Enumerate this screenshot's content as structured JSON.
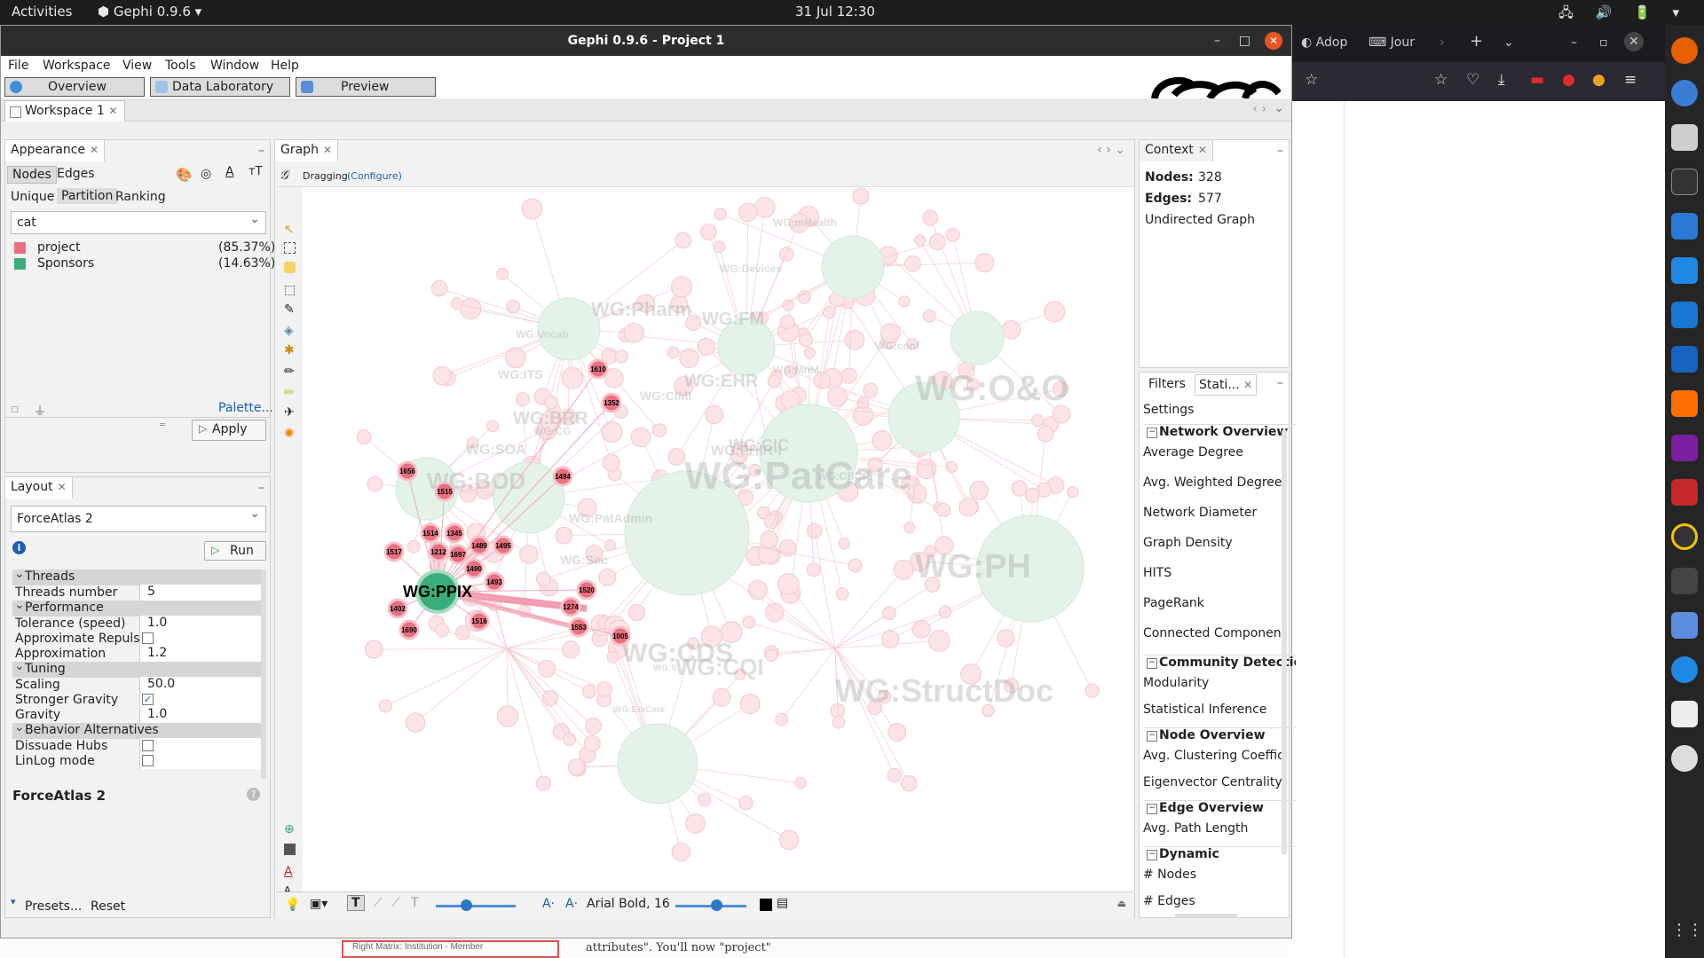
{
  "topbar": {
    "activities": "Activities",
    "app": "Gephi 0.9.6",
    "clock": "31 Jul  12:30",
    "tray": "🖧 🔊 🔋 ▾"
  },
  "window": {
    "title": "Gephi 0.9.6 - Project 1"
  },
  "menu": [
    "File",
    "Workspace",
    "View",
    "Tools",
    "Window",
    "Help"
  ],
  "modes": [
    "Overview",
    "Data Laboratory",
    "Preview"
  ],
  "workspace_tab": "Workspace 1",
  "appearance": {
    "tab": "Appearance",
    "subtabs": [
      "Nodes",
      "Edges"
    ],
    "modes": [
      "Unique",
      "Partition",
      "Ranking"
    ],
    "attribute": "cat",
    "partitions": [
      {
        "label": "project",
        "pct": "(85.37%)",
        "color": "#e8707f"
      },
      {
        "label": "Sponsors",
        "pct": "(14.63%)",
        "color": "#3aae7a"
      }
    ],
    "palette": "Palette...",
    "apply": "Apply"
  },
  "layout": {
    "tab": "Layout",
    "algorithm": "ForceAtlas 2",
    "run": "Run",
    "groups": [
      {
        "name": "Threads",
        "rows": [
          {
            "k": "Threads number",
            "v": "5"
          }
        ]
      },
      {
        "name": "Performance",
        "rows": [
          {
            "k": "Tolerance (speed)",
            "v": "1.0"
          },
          {
            "k": "Approximate Repulsion",
            "v": "",
            "cb": true,
            "checked": false
          },
          {
            "k": "Approximation",
            "v": "1.2"
          }
        ]
      },
      {
        "name": "Tuning",
        "rows": [
          {
            "k": "Scaling",
            "v": "50.0"
          },
          {
            "k": "Stronger Gravity",
            "v": "",
            "cb": true,
            "checked": true
          },
          {
            "k": "Gravity",
            "v": "1.0"
          }
        ]
      },
      {
        "name": "Behavior Alternatives",
        "rows": [
          {
            "k": "Dissuade Hubs",
            "v": "",
            "cb": true,
            "checked": false
          },
          {
            "k": "LinLog mode",
            "v": "",
            "cb": true,
            "checked": false
          }
        ]
      }
    ],
    "desc_title": "ForceAtlas 2",
    "presets": "Presets...",
    "reset": "Reset"
  },
  "graph": {
    "tab": "Graph",
    "tool": "Dragging",
    "configure": "(Configure)",
    "font": "Arial Bold, 16",
    "bg_labels": [
      "WG:PatCare",
      "WG:O&O",
      "WG:PH",
      "WG:StructDoc",
      "WG:CDS",
      "WG:CQI",
      "WG:BOD",
      "WG:Pharm",
      "WG:FM",
      "WG:EHR",
      "WG:BRR",
      "WG:CIC",
      "WG:FHIR-I",
      "WG:SOA",
      "WG:CIMI",
      "WG:ITS",
      "WG:Sec",
      "WG:PatAdmin",
      "WG:Vocab",
      "WG:MnM",
      "WG:CBCP",
      "WG:CG",
      "WG:conf",
      "WG:Devices",
      "WG:mHealth",
      "WG:II",
      "WG:EmCare"
    ],
    "hub": "WG:PPIX",
    "nodes": [
      "1610",
      "1352",
      "1656",
      "1515",
      "1494",
      "1514",
      "1345",
      "1517",
      "1212",
      "1697",
      "1489",
      "1495",
      "1490",
      "1493",
      "1520",
      "1402",
      "1274",
      "1516",
      "1553",
      "1690",
      "1005"
    ]
  },
  "context": {
    "tab": "Context",
    "nodes_label": "Nodes:",
    "nodes": "328",
    "edges_label": "Edges:",
    "edges": "577",
    "type": "Undirected Graph"
  },
  "stats": {
    "tabs": [
      "Filters",
      "Stati..."
    ],
    "settings": "Settings",
    "sections": [
      {
        "h": "Network Overview",
        "items": [
          "Average Degree",
          "Avg. Weighted Degree",
          "Network Diameter",
          "Graph Density",
          "HITS",
          "PageRank",
          "Connected Components"
        ]
      },
      {
        "h": "Community Detection",
        "items": [
          "Modularity",
          "Statistical Inference"
        ]
      },
      {
        "h": "Node Overview",
        "items": [
          "Avg. Clustering Coefficient",
          "Eigenvector Centrality"
        ]
      },
      {
        "h": "Edge Overview",
        "items": [
          "Avg. Path Length"
        ]
      },
      {
        "h": "Dynamic",
        "items": [
          "# Nodes",
          "# Edges"
        ]
      }
    ]
  },
  "firefox": {
    "tabs": [
      "Adop",
      "Jour"
    ]
  },
  "behind": {
    "text": "attributes\".  You'll  now  \"project\"",
    "box": "Right Matrix:    Institution - Member"
  }
}
